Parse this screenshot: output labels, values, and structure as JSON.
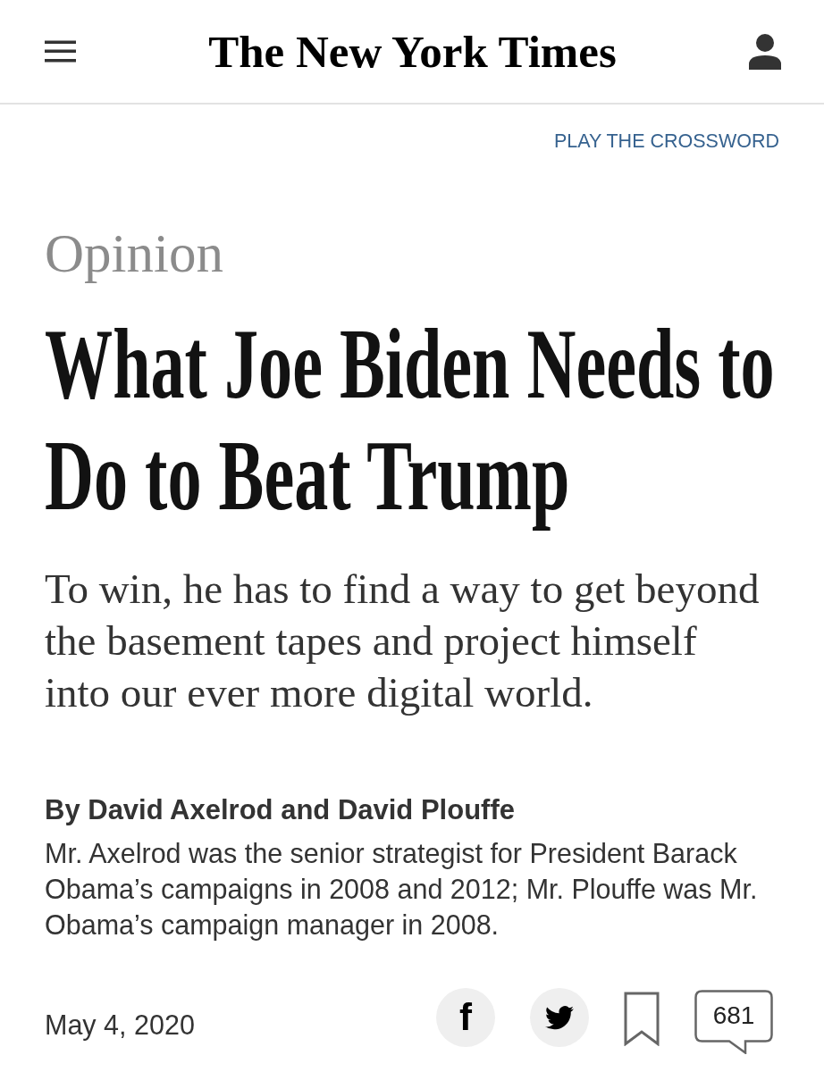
{
  "header": {
    "logo": "The New York Times"
  },
  "crossword_link": {
    "label": "PLAY THE CROSSWORD"
  },
  "article": {
    "section": "Opinion",
    "headline": "What Joe Biden Needs to Do to Beat Trump",
    "summary": "To win, he has to find a way to get beyond the basement tapes and project himself into our ever more digital world.",
    "byline": "By David Axelrod and David Plouffe",
    "author_bio": "Mr. Axelrod was the senior strategist for President Barack Obama’s campaigns in 2008 and 2012; Mr. Plouffe was Mr. Obama’s campaign manager in 2008.",
    "date": "May 4, 2020"
  },
  "actions": [
    {
      "kind": "facebook",
      "glyph": "f"
    },
    {
      "kind": "twitter"
    },
    {
      "kind": "save",
      "saved": false
    },
    {
      "kind": "comments",
      "count": "681"
    }
  ]
}
